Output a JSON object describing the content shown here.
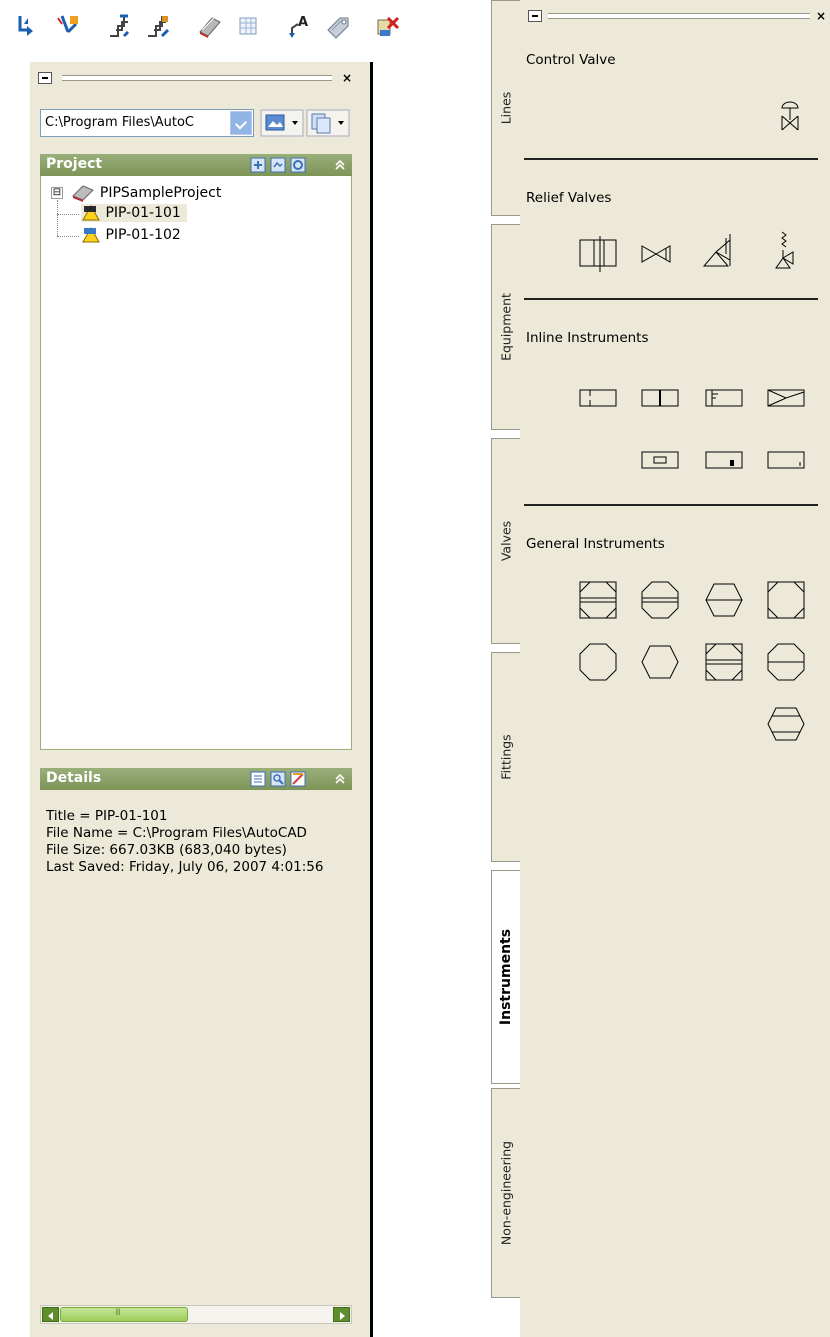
{
  "toolbar": {
    "icons": [
      "connect-line-icon",
      "disconnect-line-icon",
      "route-pipe-icon",
      "route-pipe-alt-icon",
      "project-manager-icon",
      "data-manager-icon",
      "annotate-icon",
      "tag-icon",
      "validate-icon"
    ]
  },
  "left_palette": {
    "path_combo": {
      "value": "C:\\Program Files\\AutoC"
    },
    "project": {
      "title": "Project",
      "tree": [
        {
          "label": "PIPSampleProject",
          "expander": "⊟"
        },
        {
          "label": "PIP-01-101",
          "selected": true
        },
        {
          "label": "PIP-01-102",
          "selected": false
        }
      ]
    },
    "details": {
      "title": "Details",
      "lines": [
        "Title = PIP-01-101",
        "File Name = C:\\Program  Files\\AutoCAD",
        "File Size: 667.03KB (683,040 bytes)",
        "Last Saved: Friday, July 06, 2007 4:01:56"
      ]
    },
    "scrollbar": {
      "left_icon": "scroll-left-icon",
      "right_icon": "scroll-right-icon"
    }
  },
  "right_palette": {
    "tabs": [
      {
        "label": "Lines",
        "active": false
      },
      {
        "label": "Equipment",
        "active": false
      },
      {
        "label": "Valves",
        "active": false
      },
      {
        "label": "Fittings",
        "active": false
      },
      {
        "label": "Instruments",
        "active": true
      },
      {
        "label": "Non-engineering",
        "active": false
      }
    ],
    "groups": [
      {
        "heading": "Control Valve"
      },
      {
        "heading": "Relief Valves"
      },
      {
        "heading": "Inline Instruments"
      },
      {
        "heading": "General Instruments"
      }
    ]
  },
  "colors": {
    "panel_bg": "#ece9d8",
    "section_header": "#8aa166",
    "scroll_arrow": "#5f8e2e",
    "combo_border": "#7f9db9"
  }
}
